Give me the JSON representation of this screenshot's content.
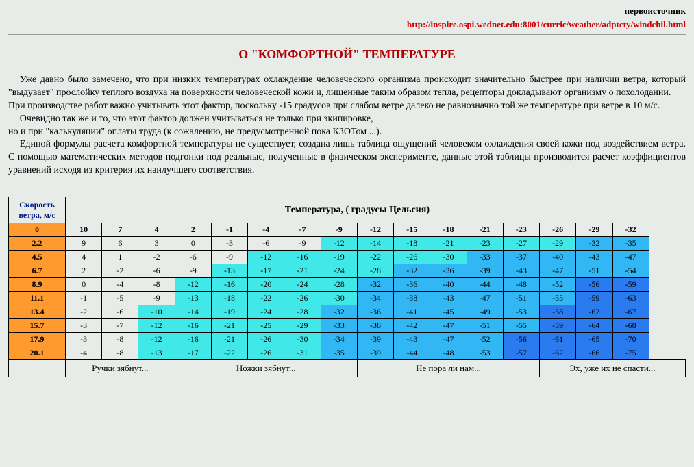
{
  "source_label": "первоисточник",
  "source_url": "http://inspire.ospi.wednet.edu:8001/curric/weather/adptcty/windchil.html",
  "title": "О \"КОМФОРТНОЙ\" ТЕМПЕРАТУРЕ",
  "paragraphs": [
    "Уже давно было замечено, что при низких температурах охлаждение человеческого организма происходит значительно быстрее при наличии ветра, который \"выдувает\" прослойку теплого воздуха на поверхности человеческой кожи и, лишенные таким образом тепла,  рецепторы докладывают организму о похолодании.",
    "При производстве работ важно учитывать этот фактор, поскольку -15 градусов при слабом  ветре далеко не равнозначно той же температуре при ветре в 10 м/с.",
    "Очевидно так же и то, что этот фактор должен учитываться не только при экипировке,",
    "но и при \"калькуляции\" оплаты труда (к сожалению, не предусмотренной пока КЗОТом ...).",
    "Единой формулы расчета комфортной температуры не существует, создана лишь таблица ощущений человеком охлаждения своей кожи под воздействием ветра. С помощью математических методов подгонки под реальные, полученные в физическом эксперименте, данные этой таблицы производится расчет  коэффициентов уравнений исходя из критерия их наилучшего соответствия."
  ],
  "table": {
    "wind_header": "Скорость ветра, м/с",
    "temp_header": "Температура, ( градусы Цельсия)",
    "temps": [
      10,
      7,
      4,
      2,
      -1,
      -4,
      -7,
      -9,
      -12,
      -15,
      -18,
      -21,
      -23,
      -26,
      -29,
      -32
    ],
    "rows": [
      {
        "wind": "0",
        "cells": [
          {
            "v": 10,
            "b": 0
          },
          {
            "v": 7,
            "b": 0
          },
          {
            "v": 4,
            "b": 0
          },
          {
            "v": 2,
            "b": 0
          },
          {
            "v": -1,
            "b": 0
          },
          {
            "v": -4,
            "b": 0
          },
          {
            "v": -7,
            "b": 0
          },
          {
            "v": -9,
            "b": 0
          },
          {
            "v": -12,
            "b": 0
          },
          {
            "v": -15,
            "b": 0
          },
          {
            "v": -18,
            "b": 0
          },
          {
            "v": -21,
            "b": 0
          },
          {
            "v": -23,
            "b": 0
          },
          {
            "v": -26,
            "b": 0
          },
          {
            "v": -29,
            "b": 0
          },
          {
            "v": -32,
            "b": 0
          }
        ]
      },
      {
        "wind": "2.2",
        "cells": [
          {
            "v": 9,
            "b": 0
          },
          {
            "v": 6,
            "b": 0
          },
          {
            "v": 3,
            "b": 0
          },
          {
            "v": 0,
            "b": 0
          },
          {
            "v": -3,
            "b": 0
          },
          {
            "v": -6,
            "b": 0
          },
          {
            "v": -9,
            "b": 0
          },
          {
            "v": -12,
            "b": 1
          },
          {
            "v": -14,
            "b": 1
          },
          {
            "v": -18,
            "b": 1
          },
          {
            "v": -21,
            "b": 1
          },
          {
            "v": -23,
            "b": 1
          },
          {
            "v": -27,
            "b": 1
          },
          {
            "v": -29,
            "b": 1
          },
          {
            "v": -32,
            "b": 2
          },
          {
            "v": -35,
            "b": 2
          }
        ]
      },
      {
        "wind": "4.5",
        "cells": [
          {
            "v": 4,
            "b": 0
          },
          {
            "v": 1,
            "b": 0
          },
          {
            "v": -2,
            "b": 0
          },
          {
            "v": -6,
            "b": 0
          },
          {
            "v": -9,
            "b": 0
          },
          {
            "v": -12,
            "b": 1
          },
          {
            "v": -16,
            "b": 1
          },
          {
            "v": -19,
            "b": 1
          },
          {
            "v": -22,
            "b": 1
          },
          {
            "v": -26,
            "b": 1
          },
          {
            "v": -30,
            "b": 1
          },
          {
            "v": -33,
            "b": 2
          },
          {
            "v": -37,
            "b": 2
          },
          {
            "v": -40,
            "b": 2
          },
          {
            "v": -43,
            "b": 2
          },
          {
            "v": -47,
            "b": 2
          }
        ]
      },
      {
        "wind": "6.7",
        "cells": [
          {
            "v": 2,
            "b": 0
          },
          {
            "v": -2,
            "b": 0
          },
          {
            "v": -6,
            "b": 0
          },
          {
            "v": -9,
            "b": 0
          },
          {
            "v": -13,
            "b": 1
          },
          {
            "v": -17,
            "b": 1
          },
          {
            "v": -21,
            "b": 1
          },
          {
            "v": -24,
            "b": 1
          },
          {
            "v": -28,
            "b": 1
          },
          {
            "v": -32,
            "b": 2
          },
          {
            "v": -36,
            "b": 2
          },
          {
            "v": -39,
            "b": 2
          },
          {
            "v": -43,
            "b": 2
          },
          {
            "v": -47,
            "b": 2
          },
          {
            "v": -51,
            "b": 2
          },
          {
            "v": -54,
            "b": 2
          }
        ]
      },
      {
        "wind": "8.9",
        "cells": [
          {
            "v": 0,
            "b": 0
          },
          {
            "v": -4,
            "b": 0
          },
          {
            "v": -8,
            "b": 0
          },
          {
            "v": -12,
            "b": 1
          },
          {
            "v": -16,
            "b": 1
          },
          {
            "v": -20,
            "b": 1
          },
          {
            "v": -24,
            "b": 1
          },
          {
            "v": -28,
            "b": 1
          },
          {
            "v": -32,
            "b": 2
          },
          {
            "v": -36,
            "b": 2
          },
          {
            "v": -40,
            "b": 2
          },
          {
            "v": -44,
            "b": 2
          },
          {
            "v": -48,
            "b": 2
          },
          {
            "v": -52,
            "b": 2
          },
          {
            "v": -56,
            "b": 3
          },
          {
            "v": -59,
            "b": 3
          }
        ]
      },
      {
        "wind": "11.1",
        "cells": [
          {
            "v": -1,
            "b": 0
          },
          {
            "v": -5,
            "b": 0
          },
          {
            "v": -9,
            "b": 0
          },
          {
            "v": -13,
            "b": 1
          },
          {
            "v": -18,
            "b": 1
          },
          {
            "v": -22,
            "b": 1
          },
          {
            "v": -26,
            "b": 1
          },
          {
            "v": -30,
            "b": 1
          },
          {
            "v": -34,
            "b": 2
          },
          {
            "v": -38,
            "b": 2
          },
          {
            "v": -43,
            "b": 2
          },
          {
            "v": -47,
            "b": 2
          },
          {
            "v": -51,
            "b": 2
          },
          {
            "v": -55,
            "b": 2
          },
          {
            "v": -59,
            "b": 3
          },
          {
            "v": -63,
            "b": 3
          }
        ]
      },
      {
        "wind": "13.4",
        "cells": [
          {
            "v": -2,
            "b": 0
          },
          {
            "v": -6,
            "b": 0
          },
          {
            "v": -10,
            "b": 1
          },
          {
            "v": -14,
            "b": 1
          },
          {
            "v": -19,
            "b": 1
          },
          {
            "v": -24,
            "b": 1
          },
          {
            "v": -28,
            "b": 1
          },
          {
            "v": -32,
            "b": 2
          },
          {
            "v": -36,
            "b": 2
          },
          {
            "v": -41,
            "b": 2
          },
          {
            "v": -45,
            "b": 2
          },
          {
            "v": -49,
            "b": 2
          },
          {
            "v": -53,
            "b": 2
          },
          {
            "v": -58,
            "b": 3
          },
          {
            "v": -62,
            "b": 3
          },
          {
            "v": -67,
            "b": 3
          }
        ]
      },
      {
        "wind": "15.7",
        "cells": [
          {
            "v": -3,
            "b": 0
          },
          {
            "v": -7,
            "b": 0
          },
          {
            "v": -12,
            "b": 1
          },
          {
            "v": -16,
            "b": 1
          },
          {
            "v": -21,
            "b": 1
          },
          {
            "v": -25,
            "b": 1
          },
          {
            "v": -29,
            "b": 1
          },
          {
            "v": -33,
            "b": 2
          },
          {
            "v": -38,
            "b": 2
          },
          {
            "v": -42,
            "b": 2
          },
          {
            "v": -47,
            "b": 2
          },
          {
            "v": -51,
            "b": 2
          },
          {
            "v": -55,
            "b": 2
          },
          {
            "v": -59,
            "b": 3
          },
          {
            "v": -64,
            "b": 3
          },
          {
            "v": -68,
            "b": 3
          }
        ]
      },
      {
        "wind": "17.9",
        "cells": [
          {
            "v": -3,
            "b": 0
          },
          {
            "v": -8,
            "b": 0
          },
          {
            "v": -12,
            "b": 1
          },
          {
            "v": -16,
            "b": 1
          },
          {
            "v": -21,
            "b": 1
          },
          {
            "v": -26,
            "b": 1
          },
          {
            "v": -30,
            "b": 1
          },
          {
            "v": -34,
            "b": 2
          },
          {
            "v": -39,
            "b": 2
          },
          {
            "v": -43,
            "b": 2
          },
          {
            "v": -47,
            "b": 2
          },
          {
            "v": -52,
            "b": 2
          },
          {
            "v": -56,
            "b": 3
          },
          {
            "v": -61,
            "b": 3
          },
          {
            "v": -65,
            "b": 3
          },
          {
            "v": -70,
            "b": 3
          }
        ]
      },
      {
        "wind": "20.1",
        "cells": [
          {
            "v": -4,
            "b": 0
          },
          {
            "v": -8,
            "b": 0
          },
          {
            "v": -13,
            "b": 1
          },
          {
            "v": -17,
            "b": 1
          },
          {
            "v": -22,
            "b": 1
          },
          {
            "v": -26,
            "b": 1
          },
          {
            "v": -31,
            "b": 1
          },
          {
            "v": -35,
            "b": 2
          },
          {
            "v": -39,
            "b": 2
          },
          {
            "v": -44,
            "b": 2
          },
          {
            "v": -48,
            "b": 2
          },
          {
            "v": -53,
            "b": 2
          },
          {
            "v": -57,
            "b": 3
          },
          {
            "v": -62,
            "b": 3
          },
          {
            "v": -66,
            "b": 3
          },
          {
            "v": -75,
            "b": 3
          }
        ]
      }
    ],
    "footer": [
      {
        "span": 3,
        "text": "Ручки зябнут..."
      },
      {
        "span": 5,
        "text": "Ножки зябнут..."
      },
      {
        "span": 5,
        "text": "Не пора ли нам..."
      },
      {
        "span": 4,
        "text": "Эх, уже их не спасти..."
      }
    ]
  }
}
